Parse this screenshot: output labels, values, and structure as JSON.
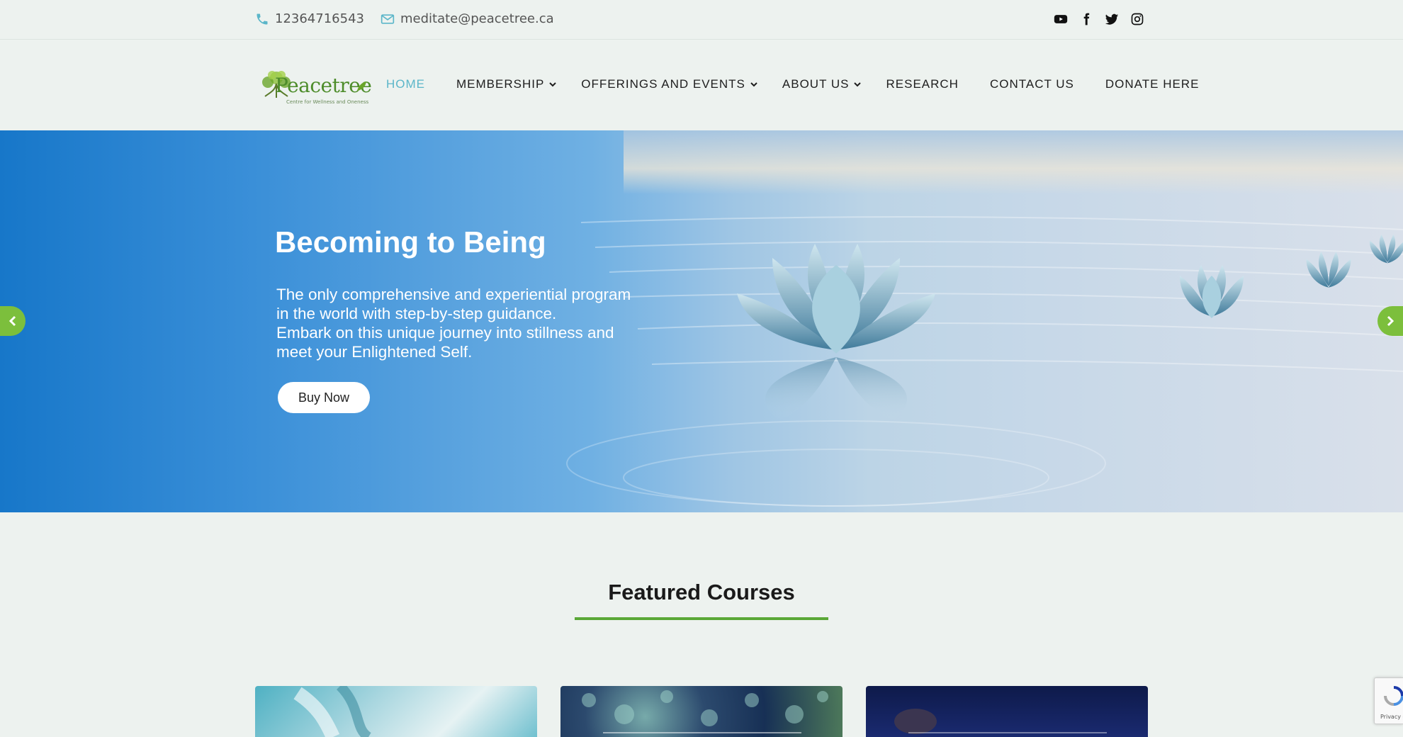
{
  "topbar": {
    "phone": "12364716543",
    "email": "meditate@peacetree.ca",
    "social_icons": [
      "youtube-icon",
      "facebook-icon",
      "twitter-icon",
      "instagram-icon"
    ]
  },
  "logo": {
    "name": "Peacetree",
    "tagline": "Centre for Wellness and Oneness"
  },
  "nav": {
    "items": [
      {
        "label": "HOME",
        "active": true,
        "dropdown": false
      },
      {
        "label": "MEMBERSHIP",
        "active": false,
        "dropdown": true
      },
      {
        "label": "OFFERINGS AND EVENTS",
        "active": false,
        "dropdown": true
      },
      {
        "label": "ABOUT US",
        "active": false,
        "dropdown": true
      },
      {
        "label": "RESEARCH",
        "active": false,
        "dropdown": false
      },
      {
        "label": "CONTACT US",
        "active": false,
        "dropdown": false
      },
      {
        "label": "DONATE HERE",
        "active": false,
        "dropdown": false
      }
    ]
  },
  "hero": {
    "title": "Becoming to Being",
    "lines": [
      "The only comprehensive and experiential program",
      "in the world with step-by-step guidance.",
      "Embark on this unique journey into stillness and",
      "meet your Enlightened Self."
    ],
    "button": "Buy Now"
  },
  "featured": {
    "title": "Featured Courses"
  },
  "recaptcha": {
    "text": "Privacy -"
  },
  "colors": {
    "accent_green": "#7cbf3c",
    "nav_active": "#5bb6c9",
    "underline": "#5aa836"
  }
}
